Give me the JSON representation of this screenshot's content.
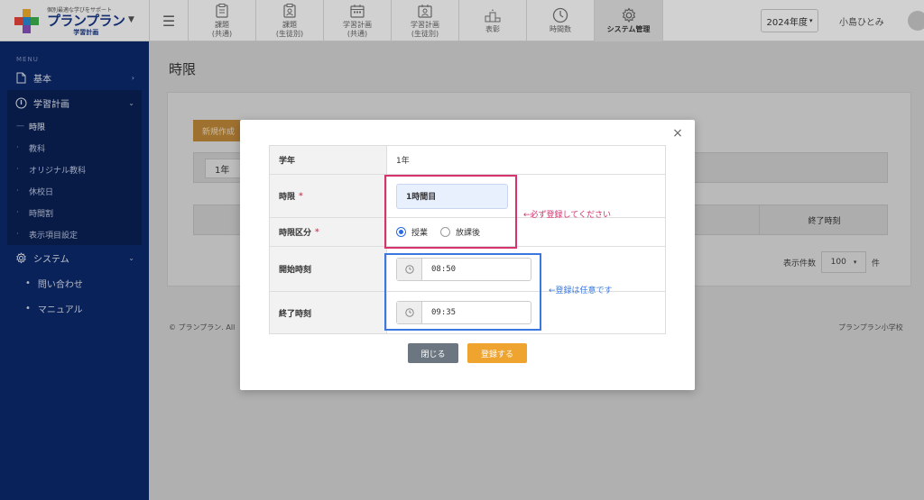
{
  "header": {
    "logo_tagline": "個別最適な学びをサポート",
    "logo_name": "プランプラン",
    "logo_sub": "学習計画",
    "tabs": [
      {
        "label": "課題\n(共通)",
        "icon": "clipboard-icon"
      },
      {
        "label": "課題\n(生徒別)",
        "icon": "clipboard-person-icon"
      },
      {
        "label": "学習計画\n(共通)",
        "icon": "calendar-icon"
      },
      {
        "label": "学習計画\n(生徒別)",
        "icon": "calendar-person-icon"
      },
      {
        "label": "表彰",
        "icon": "podium-icon"
      },
      {
        "label": "時間数",
        "icon": "clock-icon"
      },
      {
        "label": "システム管理",
        "icon": "gear-icon"
      }
    ],
    "year": "2024年度",
    "user": "小島ひとみ"
  },
  "sidebar": {
    "menu_label": "MENU",
    "basic": "基本",
    "plan": "学習計画",
    "plan_items": [
      "時限",
      "教科",
      "オリジナル教科",
      "休校日",
      "時間割",
      "表示項目設定"
    ],
    "system": "システム",
    "system_items": [
      "問い合わせ",
      "マニュアル"
    ]
  },
  "main": {
    "title": "時限",
    "new_button": "新規作成",
    "filter_value": "1年",
    "col_end_time": "終了時刻",
    "per_page_label": "表示件数",
    "per_page_value": "100",
    "per_page_unit": "件",
    "footer_left": "© プランプラン. All",
    "footer_right": "プランプラン小学校"
  },
  "modal": {
    "close_symbol": "×",
    "grade_label": "学年",
    "grade_value": "1年",
    "period_label": "時限",
    "period_value": "1時間目",
    "type_label": "時限区分",
    "type_options": [
      "授業",
      "放課後"
    ],
    "type_selected": "授業",
    "start_label": "開始時刻",
    "start_value": "08:50",
    "end_label": "終了時刻",
    "end_value": "09:35",
    "required_mark": "*",
    "annotation_required": "←必ず登録してください",
    "annotation_optional": "←登録は任意です",
    "close_button": "閉じる",
    "submit_button": "登録する"
  },
  "colors": {
    "sidebar_bg": "#0c2a6e",
    "accent_orange": "#f0a430",
    "annotation_red": "#d6336c",
    "annotation_blue": "#3a78e0"
  }
}
